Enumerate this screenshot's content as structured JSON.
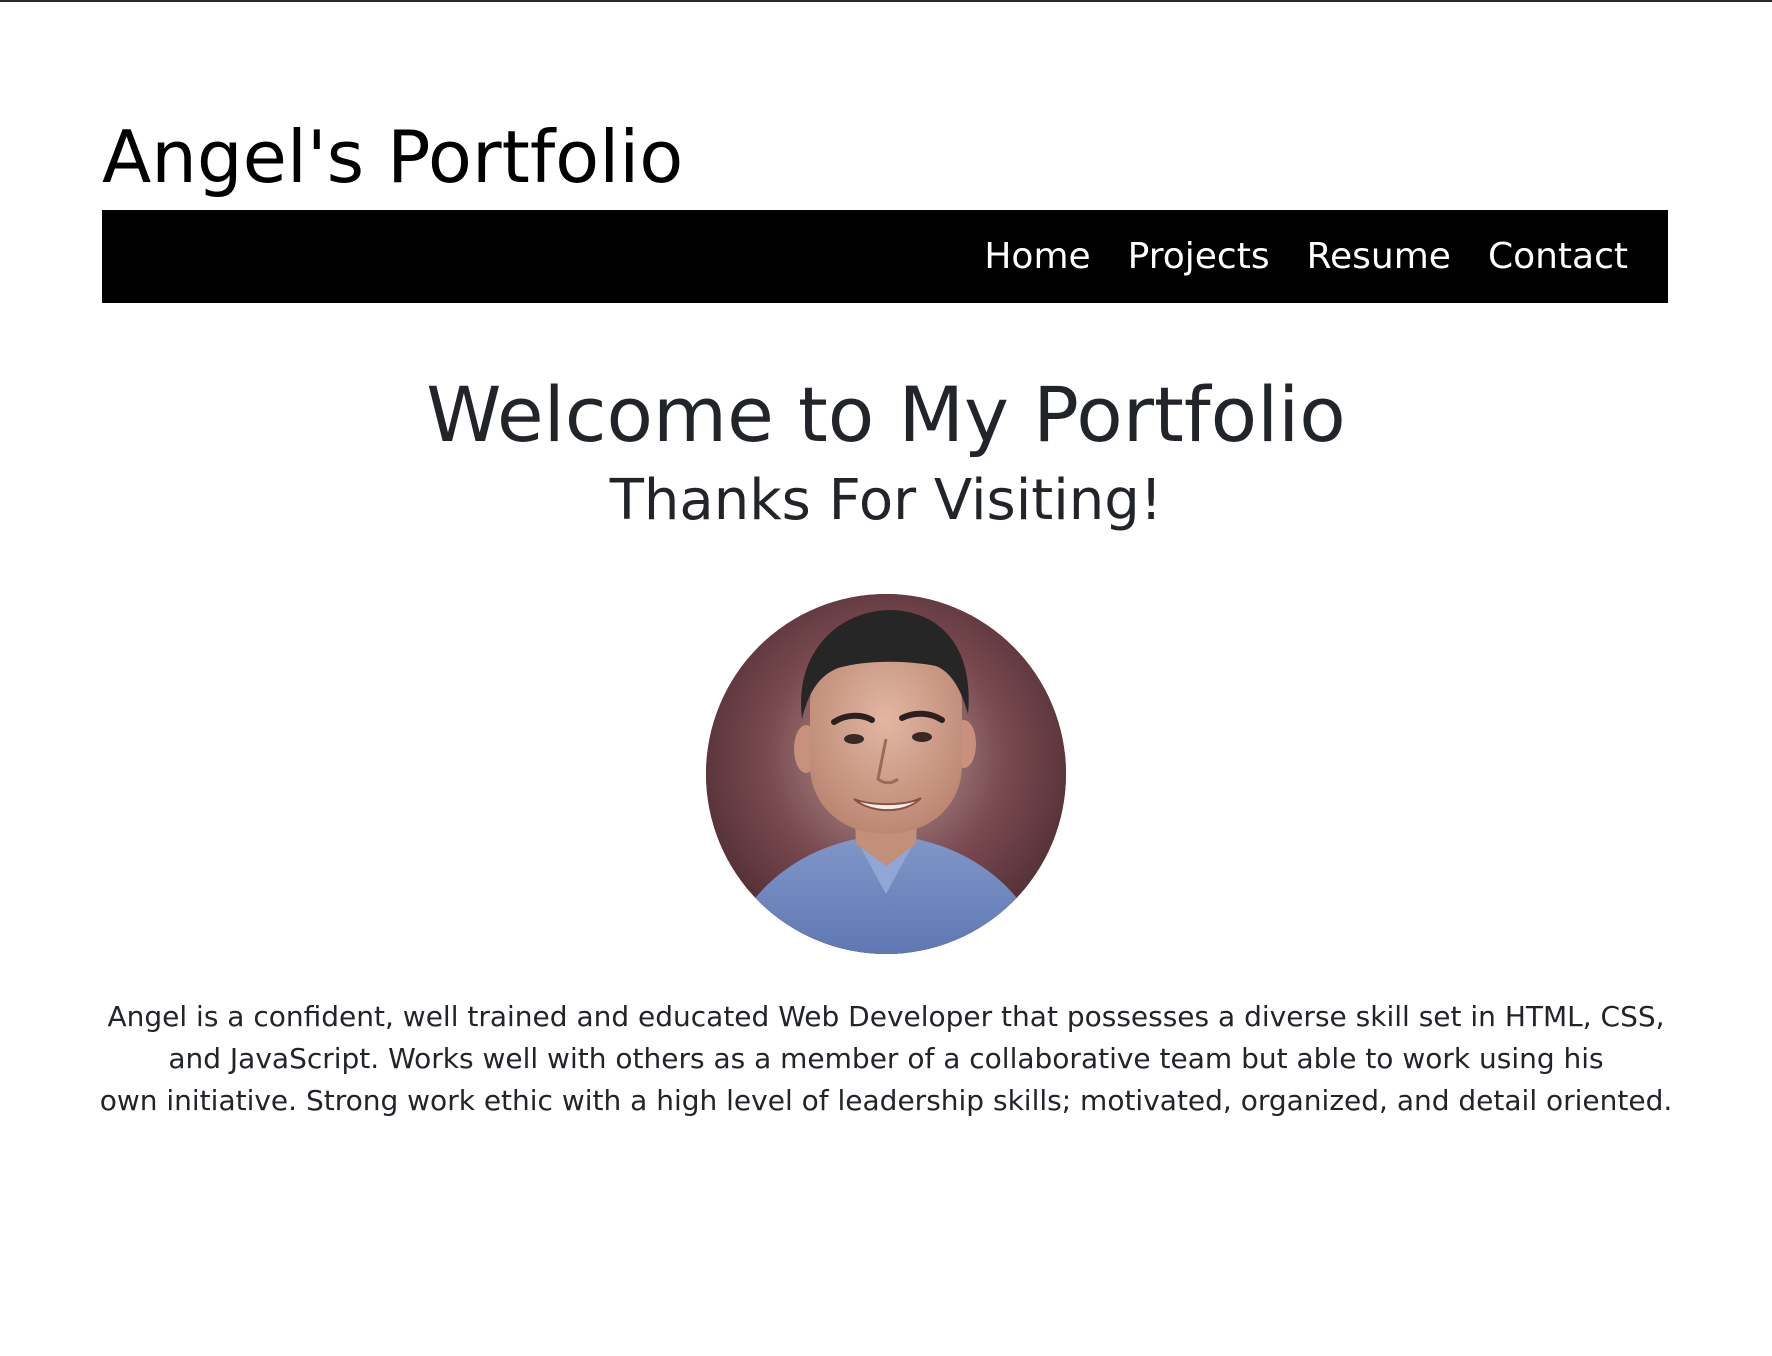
{
  "site": {
    "title": "Angel's Portfolio"
  },
  "nav": {
    "items": [
      {
        "label": "Home"
      },
      {
        "label": "Projects"
      },
      {
        "label": "Resume"
      },
      {
        "label": "Contact"
      }
    ]
  },
  "hero": {
    "title": "Welcome to My Portfolio",
    "subtitle": "Thanks For Visiting!"
  },
  "profile": {
    "photo_icon": "profile-photo"
  },
  "bio": {
    "line1": "Angel is a confident, well trained and educated Web Developer that possesses a diverse skill set in HTML, CSS,",
    "line2": "and JavaScript. Works well with others as a member of a collaborative team but able to work using his",
    "line3": "own initiative. Strong work ethic with a high level of leadership skills; motivated, organized, and detail oriented."
  },
  "colors": {
    "navbar_background": "#000000",
    "nav_text": "#ffffff",
    "body_text": "#212529",
    "page_background": "#ffffff"
  }
}
